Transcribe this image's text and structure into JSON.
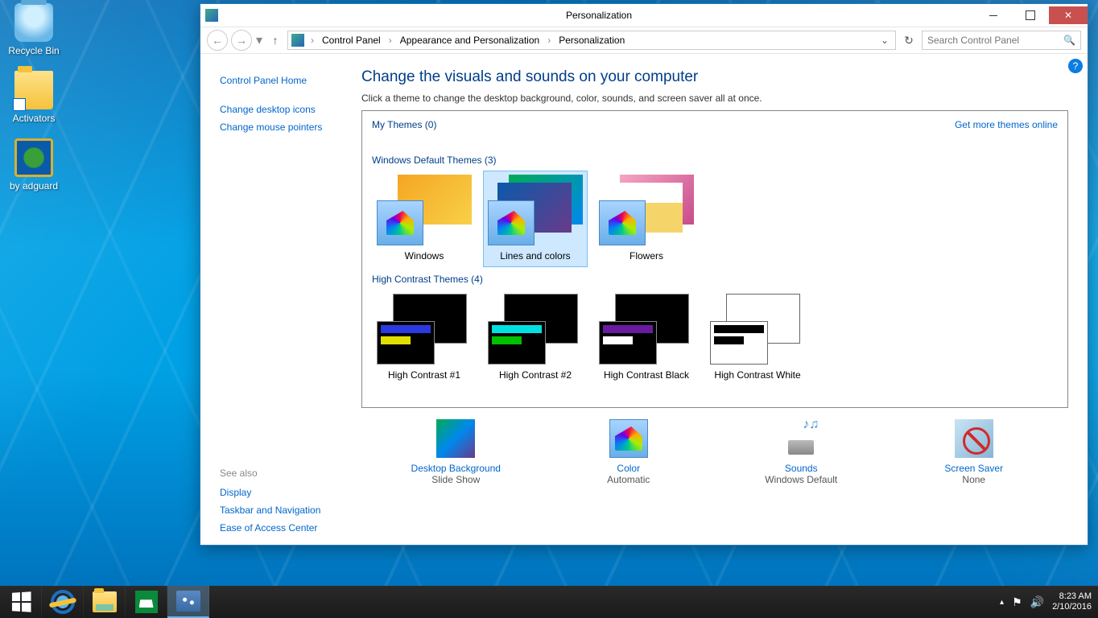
{
  "desktop": {
    "icons": [
      {
        "name": "recycle",
        "label": "Recycle Bin"
      },
      {
        "name": "activators",
        "label": "Activators"
      },
      {
        "name": "adguard",
        "label": "by adguard"
      }
    ]
  },
  "window": {
    "title": "Personalization",
    "breadcrumb": [
      "Control Panel",
      "Appearance and Personalization",
      "Personalization"
    ],
    "search_placeholder": "Search Control Panel",
    "sidebar": {
      "home": "Control Panel Home",
      "links": [
        "Change desktop icons",
        "Change mouse pointers"
      ],
      "seealso_header": "See also",
      "seealso": [
        "Display",
        "Taskbar and Navigation",
        "Ease of Access Center"
      ]
    },
    "main": {
      "heading": "Change the visuals and sounds on your computer",
      "subtext": "Click a theme to change the desktop background, color, sounds, and screen saver all at once.",
      "my_themes_label": "My Themes (0)",
      "more_online": "Get more themes online",
      "default_label": "Windows Default Themes (3)",
      "default_themes": [
        "Windows",
        "Lines and colors",
        "Flowers"
      ],
      "selected_theme": "Lines and colors",
      "hc_label": "High Contrast Themes (4)",
      "hc_themes": [
        "High Contrast #1",
        "High Contrast #2",
        "High Contrast Black",
        "High Contrast White"
      ],
      "bottom": [
        {
          "label": "Desktop Background",
          "value": "Slide Show"
        },
        {
          "label": "Color",
          "value": "Automatic"
        },
        {
          "label": "Sounds",
          "value": "Windows Default"
        },
        {
          "label": "Screen Saver",
          "value": "None"
        }
      ]
    }
  },
  "taskbar": {
    "time": "8:23 AM",
    "date": "2/10/2016"
  }
}
